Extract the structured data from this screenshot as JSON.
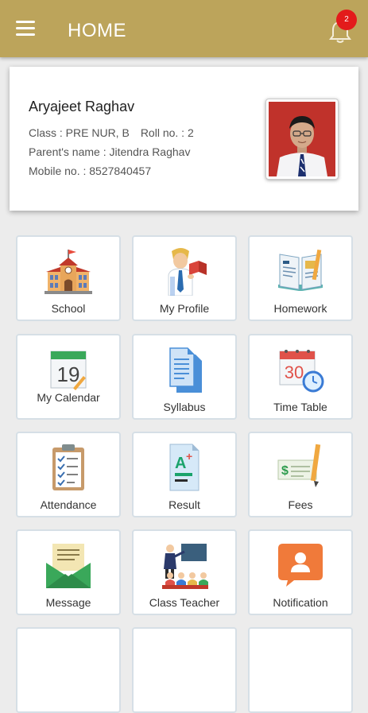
{
  "header": {
    "title": "HOME",
    "notification_count": "2"
  },
  "profile": {
    "name": "Aryajeet Raghav",
    "class_text": "Class : PRE NUR, B",
    "roll_text": "Roll no. : 2",
    "parent_text": "Parent's name : Jitendra Raghav",
    "mobile_text": "Mobile no. : 8527840457"
  },
  "tiles": [
    {
      "label": "School",
      "icon": "school-building-icon"
    },
    {
      "label": "My Profile",
      "icon": "student-profile-icon"
    },
    {
      "label": "Homework",
      "icon": "homework-book-icon"
    },
    {
      "label": "My Calendar",
      "icon": "calendar-icon"
    },
    {
      "label": "Syllabus",
      "icon": "syllabus-documents-icon"
    },
    {
      "label": "Time Table",
      "icon": "timetable-calendar-clock-icon"
    },
    {
      "label": "Attendance",
      "icon": "attendance-clipboard-icon"
    },
    {
      "label": "Result",
      "icon": "result-grade-icon"
    },
    {
      "label": "Fees",
      "icon": "fees-cheque-icon"
    },
    {
      "label": "Message",
      "icon": "message-envelope-icon"
    },
    {
      "label": "Class Teacher",
      "icon": "class-teacher-icon"
    },
    {
      "label": "Notification",
      "icon": "notification-chat-icon"
    }
  ],
  "calendar_icon_day": "19",
  "timetable_icon_day": "30"
}
